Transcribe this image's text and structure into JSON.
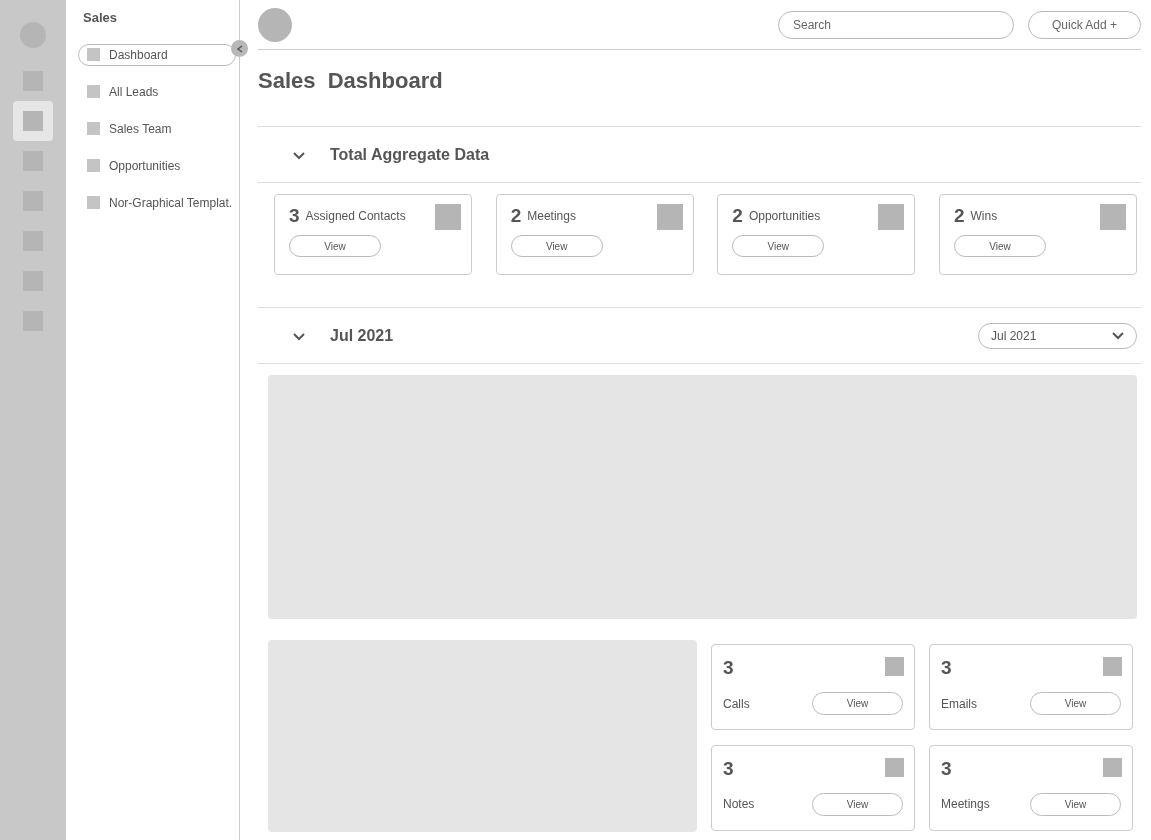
{
  "rail": [
    {
      "selected": false
    },
    {
      "selected": true
    },
    {
      "selected": false
    },
    {
      "selected": false
    },
    {
      "selected": false
    },
    {
      "selected": false
    },
    {
      "selected": false
    }
  ],
  "sidebar": {
    "title": "Sales",
    "items": [
      {
        "label": "Dashboard",
        "selected": true
      },
      {
        "label": "All Leads",
        "selected": false
      },
      {
        "label": "Sales Team",
        "selected": false
      },
      {
        "label": "Opportunities",
        "selected": false
      },
      {
        "label": "Nor-Graphical Templat.",
        "selected": false
      }
    ]
  },
  "topbar": {
    "search": {
      "placeholder": "Search"
    },
    "quick_add": "Quick Add +"
  },
  "title": "Sales  Dashboard",
  "aggregate": {
    "heading": "Total Aggregate Data",
    "expanded": true,
    "cards": [
      {
        "count": "3",
        "label": "Assigned Contacts",
        "button": "View"
      },
      {
        "count": "2",
        "label": "Meetings",
        "button": "View"
      },
      {
        "count": "2",
        "label": "Opportunities",
        "button": "View"
      },
      {
        "count": "2",
        "label": "Wins",
        "button": "View"
      }
    ]
  },
  "month": {
    "heading": "Jul 2021",
    "expanded": true,
    "dropdown": "Jul 2021",
    "cards": [
      {
        "count": "3",
        "label": "Calls",
        "button": "View"
      },
      {
        "count": "3",
        "label": "Emails",
        "button": "View"
      },
      {
        "count": "3",
        "label": "Notes",
        "button": "View"
      },
      {
        "count": "3",
        "label": "Meetings",
        "button": "View"
      }
    ]
  }
}
